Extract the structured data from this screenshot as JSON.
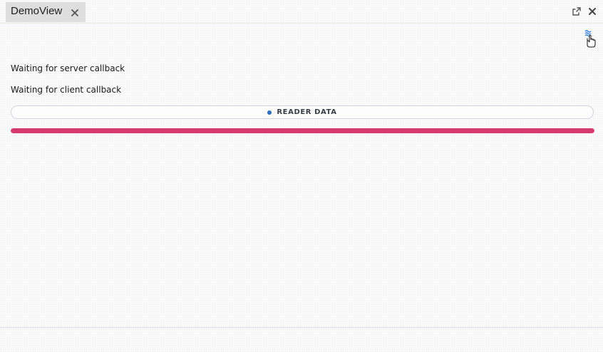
{
  "tab": {
    "title": "DemoView",
    "close_icon": "close-icon"
  },
  "window": {
    "popout_icon": "external-link-icon",
    "close_icon": "close-icon"
  },
  "status": {
    "server": "Waiting for server callback",
    "client": "Waiting for client callback"
  },
  "reader_button": {
    "label": "READER DATA",
    "dot_color": "#2d6fbf"
  },
  "progress": {
    "value_percent": 100,
    "color": "#d63a6f"
  },
  "indicator": {
    "icon": "wave-indicator-icon",
    "cursor": "hand-pointer-cursor-icon",
    "color": "#2d7fd8"
  }
}
